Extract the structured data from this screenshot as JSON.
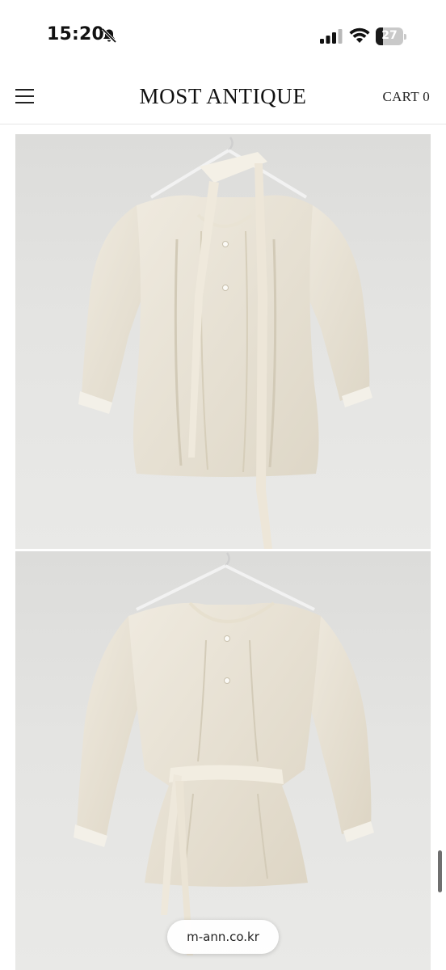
{
  "status_bar": {
    "time": "15:20",
    "battery_level": "27"
  },
  "header": {
    "brand": "MOST ANTIQUE",
    "cart_label": "CART 0"
  },
  "icons": {
    "menu": "hamburger-menu-icon",
    "bell": "bell-slash-icon",
    "signal": "cellular-signal-icon",
    "wifi": "wifi-icon",
    "battery": "battery-icon"
  },
  "colors": {
    "garment": "#ece7da",
    "background": "#e2e2e0",
    "text": "#111111"
  },
  "url_bar": {
    "domain": "m-ann.co.kr"
  }
}
